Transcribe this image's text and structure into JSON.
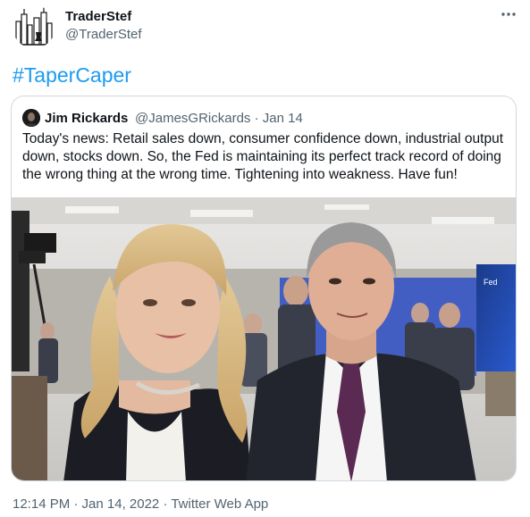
{
  "tweet": {
    "author_name": "TraderStef",
    "author_handle": "@TraderStef",
    "more_label": "···",
    "text": "#TaperCaper",
    "timestamp": "12:14 PM · Jan 14, 2022 · Twitter Web App"
  },
  "quoted_tweet": {
    "author_name": "Jim Rickards",
    "meta": "@JamesGRickards · Jan 14",
    "text": "Today's news: Retail sales down, consumer confidence down, industrial output down, stocks down. So, the Fed is maintaining its perfect track record of doing the wrong thing at the wrong time. Tightening into weakness. Have fun!",
    "screen_text": "Fed"
  },
  "colors": {
    "link": "#1d9bf0",
    "secondary_text": "#536471",
    "border": "#cfd9de"
  },
  "icons": {
    "avatar": "city-skyline-avatar-icon",
    "more": "more-options-icon"
  }
}
